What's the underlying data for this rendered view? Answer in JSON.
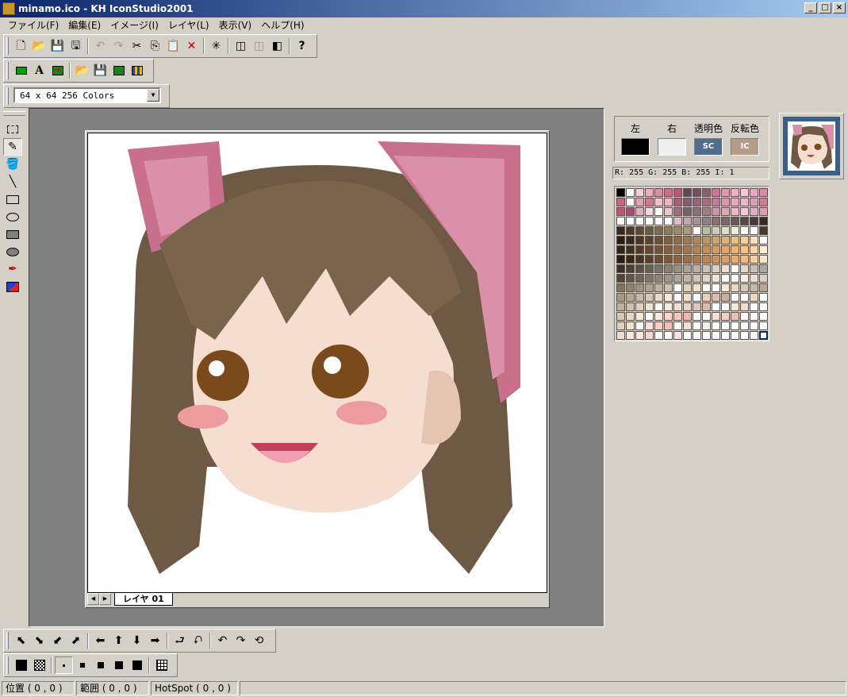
{
  "window": {
    "title": "minamo.ico - KH IconStudio2001",
    "minimize": "_",
    "maximize": "□",
    "close": "×"
  },
  "menu": [
    "ファイル(F)",
    "編集(E)",
    "イメージ(I)",
    "レイヤ(L)",
    "表示(V)",
    "ヘルプ(H)"
  ],
  "size_select": {
    "value": "64 x 64 256 Colors",
    "arrow": "▼"
  },
  "layer_tab": {
    "label": "レイヤ 01",
    "prev": "◀",
    "next": "▶"
  },
  "colors": {
    "left_label": "左",
    "right_label": "右",
    "transparent_label": "透明色",
    "invert_label": "反転色",
    "left_color": "#000000",
    "right_color": "#eeeeee",
    "transparent_text": "SC",
    "transparent_color": "#506c8c",
    "invert_text": "IC",
    "invert_color": "#b49c88"
  },
  "rgb_readout": "R: 255 G: 255 B: 255 I:    1",
  "statusbar": {
    "position": "位置 ( 0 , 0 )",
    "range": "範囲 ( 0 , 0 )",
    "hotspot": "HotSpot ( 0 , 0 )"
  },
  "icons": {
    "main_toolbar": [
      "new-file-icon",
      "open-folder-icon",
      "save-icon",
      "save-all-icon",
      "undo-icon",
      "redo-icon",
      "cut-icon",
      "copy-icon",
      "paste-icon",
      "delete-icon",
      "sparkle-icon",
      "capture-icon",
      "capture2-icon",
      "capture3-icon",
      "help-icon"
    ],
    "second_toolbar": [
      "green-rect-icon",
      "text-icon",
      "import-icon",
      "open-image-icon",
      "save-image-icon",
      "export-icon",
      "palette-edit-icon"
    ],
    "tools": [
      "select-rect-icon",
      "pencil-icon",
      "fill-icon",
      "line-icon",
      "rect-icon",
      "ellipse-icon",
      "filled-rect-icon",
      "filled-ellipse-icon",
      "eyedropper-icon",
      "swap-color-icon"
    ],
    "bottom_toolbar": [
      "shift-up-left-icon",
      "shift-down-right-icon",
      "shift-down-left-icon",
      "shift-up-right-icon",
      "shift-left-icon",
      "shift-up-icon",
      "shift-down-icon",
      "shift-right-icon",
      "flip-horizontal-icon",
      "flip-vertical-icon",
      "rotate-left-icon",
      "rotate-right-icon",
      "rotate-180-icon"
    ],
    "brush_toolbar": [
      "fill-solid-icon",
      "fill-checker-icon",
      "brush-1-icon",
      "brush-2-icon",
      "brush-3-icon",
      "brush-4-icon",
      "brush-5-icon",
      "grid-icon"
    ]
  }
}
